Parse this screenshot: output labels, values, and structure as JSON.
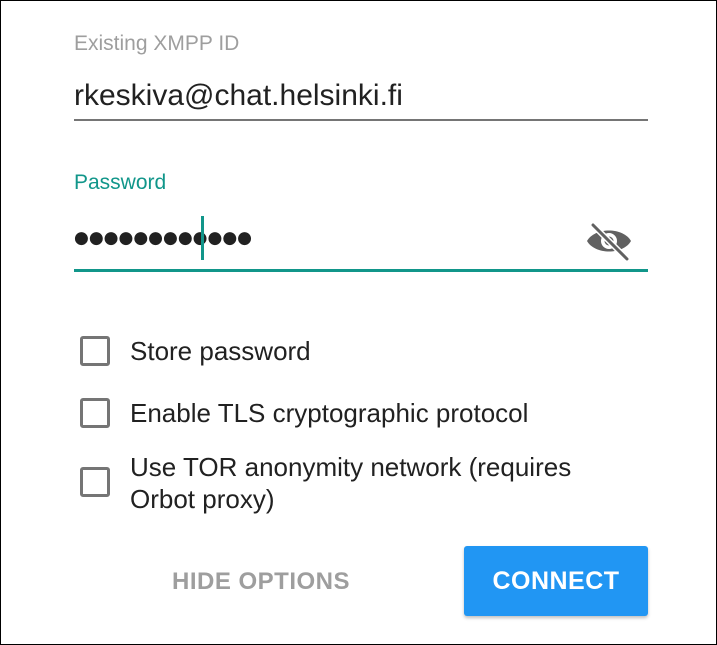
{
  "form": {
    "xmpp_id": {
      "label": "Existing XMPP ID",
      "value": "rkeskiva@chat.helsinki.fi"
    },
    "password": {
      "label": "Password",
      "masked_value": "●●●●●●●●●●●●",
      "visibility_icon": "eye-off-icon"
    }
  },
  "options": [
    {
      "label": "Store password",
      "checked": false
    },
    {
      "label": "Enable TLS cryptographic protocol",
      "checked": false
    },
    {
      "label": "Use TOR anonymity network (requires Orbot proxy)",
      "checked": false
    }
  ],
  "actions": {
    "hide_options_label": "HIDE OPTIONS",
    "connect_label": "CONNECT"
  },
  "colors": {
    "accent": "#11968a",
    "primary_button": "#2196f3",
    "label_inactive": "#9e9e9e"
  }
}
